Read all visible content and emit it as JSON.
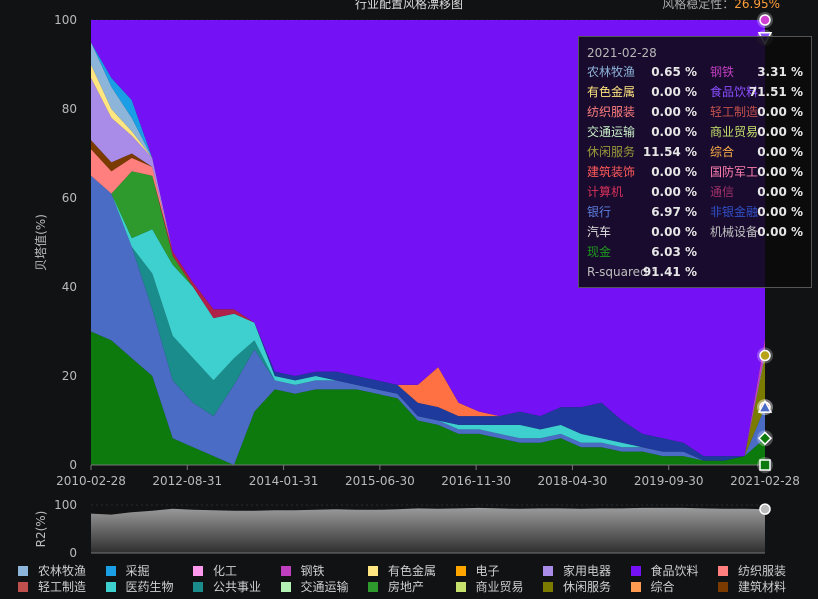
{
  "header": {
    "title": "行业配置风格漂移图",
    "stability_label": "风格稳定性：",
    "stability_value": "26.95%"
  },
  "chart_data": [
    {
      "type": "area",
      "ylabel": "贝塔值(%)",
      "ylim": [
        0,
        100
      ],
      "yticks": [
        0,
        20,
        40,
        60,
        80,
        100
      ],
      "x_tick_labels": [
        "2010-02-28",
        "2012-08-31",
        "2014-01-31",
        "2015-06-30",
        "2016-11-30",
        "2018-04-30",
        "2019-09-30",
        "2021-02-28"
      ],
      "x": [
        "2010-02",
        "2010-06",
        "2010-10",
        "2011-02",
        "2011-06",
        "2011-10",
        "2012-02",
        "2012-06",
        "2012-10",
        "2013-02",
        "2013-06",
        "2013-10",
        "2014-02",
        "2014-06",
        "2014-10",
        "2015-02",
        "2015-06",
        "2015-10",
        "2016-02",
        "2016-06",
        "2016-10",
        "2017-02",
        "2017-06",
        "2017-10",
        "2018-02",
        "2018-06",
        "2018-10",
        "2019-02",
        "2019-06",
        "2019-10",
        "2020-02",
        "2020-06",
        "2020-10",
        "2021-02"
      ],
      "series": [
        {
          "name": "现金",
          "color": "#0d7a0d",
          "values": [
            30,
            28,
            24,
            20,
            6,
            4,
            2,
            0,
            12,
            17,
            16,
            17,
            17,
            17,
            16,
            15,
            10,
            9,
            7,
            7,
            6,
            5,
            5,
            6,
            4,
            4,
            3,
            3,
            2,
            2,
            1,
            1,
            2,
            6.03
          ]
        },
        {
          "name": "银行",
          "color": "#4a6cc4",
          "values": [
            35,
            33,
            25,
            15,
            13,
            10,
            9,
            18,
            14,
            2,
            2,
            2,
            2,
            1,
            1,
            1,
            1,
            1,
            1,
            1,
            1,
            1,
            1,
            1,
            1,
            1,
            1,
            1,
            1,
            1,
            0,
            0,
            0,
            6.97
          ]
        },
        {
          "name": "公共事业",
          "color": "#1a8c8c",
          "values": [
            0,
            0,
            0,
            8,
            10,
            10,
            8,
            6,
            2,
            0,
            0,
            0,
            0,
            0,
            0,
            0,
            0,
            0,
            0,
            0,
            0,
            0,
            0,
            0,
            0,
            0,
            0,
            0,
            0,
            0,
            0,
            0,
            0,
            0
          ]
        },
        {
          "name": "医药生物",
          "color": "#3ecfcf",
          "values": [
            0,
            0,
            2,
            10,
            16,
            16,
            14,
            10,
            4,
            1,
            1,
            1,
            0,
            0,
            0,
            0,
            0,
            0,
            1,
            1,
            2,
            3,
            2,
            2,
            2,
            1,
            1,
            0,
            0,
            0,
            0,
            0,
            0,
            0
          ]
        },
        {
          "name": "房地产",
          "color": "#2e9a2e",
          "values": [
            0,
            0,
            15,
            12,
            2,
            0,
            0,
            0,
            0,
            0,
            0,
            0,
            0,
            0,
            0,
            0,
            0,
            0,
            0,
            0,
            0,
            0,
            0,
            0,
            0,
            0,
            0,
            0,
            0,
            0,
            0,
            0,
            0,
            0
          ]
        },
        {
          "name": "非银金融",
          "color": "#1e3a9c",
          "values": [
            0,
            0,
            0,
            0,
            0,
            0,
            0,
            0,
            0,
            1,
            1,
            1,
            2,
            2,
            2,
            2,
            3,
            3,
            2,
            2,
            2,
            3,
            3,
            4,
            6,
            8,
            5,
            3,
            3,
            2,
            1,
            1,
            0,
            0
          ]
        },
        {
          "name": "商业贸易",
          "color": "#b7a21a",
          "values": [
            0,
            0,
            0,
            0,
            0,
            0,
            0,
            0,
            0,
            0,
            0,
            0,
            0,
            0,
            0,
            0,
            0,
            0,
            0,
            0,
            0,
            0,
            0,
            0,
            0,
            0,
            0,
            0,
            0,
            0,
            0,
            0,
            0,
            0
          ]
        },
        {
          "name": "综合",
          "color": "#ff7043",
          "values": [
            0,
            0,
            0,
            0,
            0,
            0,
            0,
            0,
            0,
            0,
            0,
            0,
            0,
            0,
            0,
            0,
            4,
            9,
            3,
            1,
            0,
            0,
            0,
            0,
            0,
            0,
            0,
            0,
            0,
            0,
            0,
            0,
            0,
            0
          ]
        },
        {
          "name": "计算机",
          "color": "#b0214a",
          "values": [
            0,
            0,
            0,
            0,
            1,
            1,
            2,
            1,
            0,
            0,
            0,
            0,
            0,
            0,
            0,
            0,
            0,
            0,
            0,
            0,
            0,
            0,
            0,
            0,
            0,
            0,
            0,
            0,
            0,
            0,
            0,
            0,
            0,
            0
          ]
        },
        {
          "name": "纺织服装",
          "color": "#ff7f7f",
          "values": [
            6,
            5,
            3,
            2,
            0,
            0,
            0,
            0,
            0,
            0,
            0,
            0,
            0,
            0,
            0,
            0,
            0,
            0,
            0,
            0,
            0,
            0,
            0,
            0,
            0,
            0,
            0,
            0,
            0,
            0,
            0,
            0,
            0,
            0
          ]
        },
        {
          "name": "建筑材料",
          "color": "#7a3a00",
          "values": [
            2,
            2,
            1,
            0,
            0,
            0,
            0,
            0,
            0,
            0,
            0,
            0,
            0,
            0,
            0,
            0,
            0,
            0,
            0,
            0,
            0,
            0,
            0,
            0,
            0,
            0,
            0,
            0,
            0,
            0,
            0,
            0,
            0,
            0
          ]
        },
        {
          "name": "休闲服务",
          "color": "#7b7b00",
          "values": [
            0,
            0,
            0,
            0,
            0,
            0,
            0,
            0,
            0,
            0,
            0,
            0,
            0,
            0,
            0,
            0,
            0,
            0,
            0,
            0,
            0,
            0,
            0,
            0,
            0,
            0,
            0,
            0,
            0,
            0,
            0,
            0,
            0,
            11.54
          ]
        },
        {
          "name": "家用电器",
          "color": "#a98be8",
          "values": [
            14,
            10,
            4,
            2,
            0,
            0,
            0,
            0,
            0,
            0,
            0,
            0,
            0,
            0,
            0,
            0,
            0,
            0,
            0,
            0,
            0,
            0,
            0,
            0,
            0,
            0,
            0,
            0,
            0,
            0,
            0,
            0,
            0,
            0
          ]
        },
        {
          "name": "有色金属",
          "color": "#ffe680",
          "values": [
            3,
            2,
            1,
            0,
            0,
            0,
            0,
            0,
            0,
            0,
            0,
            0,
            0,
            0,
            0,
            0,
            0,
            0,
            0,
            0,
            0,
            0,
            0,
            0,
            0,
            0,
            0,
            0,
            0,
            0,
            0,
            0,
            0,
            0
          ]
        },
        {
          "name": "农林牧渔",
          "color": "#8db4d9",
          "values": [
            5,
            5,
            3,
            0,
            0,
            0,
            0,
            0,
            0,
            0,
            0,
            0,
            0,
            0,
            0,
            0,
            0,
            0,
            0,
            0,
            0,
            0,
            0,
            0,
            0,
            0,
            0,
            0,
            0,
            0,
            0,
            0,
            0,
            0.65
          ]
        },
        {
          "name": "采掘",
          "color": "#1a9ee6",
          "values": [
            0,
            2,
            4,
            0,
            0,
            0,
            0,
            0,
            0,
            0,
            0,
            0,
            0,
            0,
            0,
            0,
            0,
            0,
            0,
            0,
            0,
            0,
            0,
            0,
            0,
            0,
            0,
            0,
            0,
            0,
            0,
            0,
            0,
            0
          ]
        },
        {
          "name": "钢铁",
          "color": "#c03fc0",
          "values": [
            0,
            0,
            0,
            0,
            0,
            0,
            0,
            0,
            0,
            0,
            0,
            0,
            0,
            0,
            0,
            0,
            0,
            0,
            0,
            0,
            0,
            0,
            0,
            0,
            0,
            0,
            0,
            0,
            0,
            0,
            0,
            0,
            0,
            3.31
          ]
        },
        {
          "name": "食品饮料",
          "color": "#7411f5",
          "values": [
            5,
            13,
            18,
            31,
            52,
            59,
            65,
            65,
            68,
            79,
            80,
            79,
            79,
            80,
            81,
            82,
            82,
            78,
            86,
            88,
            89,
            88,
            89,
            87,
            87,
            86,
            90,
            93,
            94,
            95,
            98,
            98,
            98,
            71.51
          ]
        }
      ]
    },
    {
      "type": "area",
      "ylabel": "R2(%)",
      "ylim": [
        0,
        100
      ],
      "yticks": [
        0,
        100
      ],
      "x": [
        "2010-02",
        "2010-06",
        "2010-10",
        "2011-02",
        "2011-06",
        "2011-10",
        "2012-02",
        "2012-06",
        "2012-10",
        "2013-02",
        "2013-06",
        "2013-10",
        "2014-02",
        "2014-06",
        "2014-10",
        "2015-02",
        "2015-06",
        "2015-10",
        "2016-02",
        "2016-06",
        "2016-10",
        "2017-02",
        "2017-06",
        "2017-10",
        "2018-02",
        "2018-06",
        "2018-10",
        "2019-02",
        "2019-06",
        "2019-10",
        "2020-02",
        "2020-06",
        "2020-10",
        "2021-02"
      ],
      "series": [
        {
          "name": "R-squared",
          "color": "#9a9a9a",
          "values": [
            82,
            80,
            85,
            88,
            92,
            90,
            89,
            88,
            88,
            89,
            89,
            90,
            91,
            90,
            90,
            91,
            93,
            92,
            93,
            94,
            93,
            92,
            93,
            93,
            92,
            93,
            93,
            94,
            94,
            94,
            93,
            92,
            92,
            91.41
          ]
        }
      ]
    }
  ],
  "tooltip": {
    "date": "2021-02-28",
    "rows": [
      {
        "l_name": "农林牧渔",
        "l_val": "0.65 %",
        "l_color": "#8db4d9",
        "r_name": "钢铁",
        "r_val": "3.31 %",
        "r_color": "#c03fc0"
      },
      {
        "l_name": "有色金属",
        "l_val": "0.00 %",
        "l_color": "#ffe680",
        "r_name": "食品饮料",
        "r_val": "71.51 %",
        "r_color": "#8a4dff"
      },
      {
        "l_name": "纺织服装",
        "l_val": "0.00 %",
        "l_color": "#ff7f7f",
        "r_name": "轻工制造",
        "r_val": "0.00 %",
        "r_color": "#c0504d"
      },
      {
        "l_name": "交通运输",
        "l_val": "0.00 %",
        "l_color": "#c8f0c8",
        "r_name": "商业贸易",
        "r_val": "0.00 %",
        "r_color": "#c6e26c"
      },
      {
        "l_name": "休闲服务",
        "l_val": "11.54 %",
        "l_color": "#9a9a3a",
        "r_name": "综合",
        "r_val": "0.00 %",
        "r_color": "#ffb04a"
      },
      {
        "l_name": "建筑装饰",
        "l_val": "0.00 %",
        "l_color": "#ff5a5a",
        "r_name": "国防军工",
        "r_val": "0.00 %",
        "r_color": "#ff7fb0"
      },
      {
        "l_name": "计算机",
        "l_val": "0.00 %",
        "l_color": "#d6315a",
        "r_name": "通信",
        "r_val": "0.00 %",
        "r_color": "#a0306a"
      },
      {
        "l_name": "银行",
        "l_val": "6.97 %",
        "l_color": "#5b7fe0",
        "r_name": "非银金融",
        "r_val": "0.00 %",
        "r_color": "#3050c8"
      },
      {
        "l_name": "汽车",
        "l_val": "0.00 %",
        "l_color": "#e0e0e0",
        "r_name": "机械设备",
        "r_val": "0.00 %",
        "r_color": "#bfbfbf"
      },
      {
        "l_name": "现金",
        "l_val": "6.03 %",
        "l_color": "#1c9a1c",
        "r_name": "",
        "r_val": "",
        "r_color": "#bfbfbf"
      },
      {
        "l_name": "R-squared :",
        "l_val": "91.41 %",
        "l_color": "#bfbfbf",
        "r_name": "",
        "r_val": "",
        "r_color": "#bfbfbf"
      }
    ]
  },
  "legend": {
    "items": [
      {
        "label": "农林牧渔",
        "color": "#8db4d9"
      },
      {
        "label": "采掘",
        "color": "#1a9ee6"
      },
      {
        "label": "化工",
        "color": "#ff99ee"
      },
      {
        "label": "钢铁",
        "color": "#c03fc0"
      },
      {
        "label": "有色金属",
        "color": "#ffe680"
      },
      {
        "label": "电子",
        "color": "#ffa500"
      },
      {
        "label": "家用电器",
        "color": "#a98be8"
      },
      {
        "label": "食品饮料",
        "color": "#7411f5"
      },
      {
        "label": "纺织服装",
        "color": "#ff7f7f"
      },
      {
        "label": "轻工制造",
        "color": "#c0504d"
      },
      {
        "label": "医药生物",
        "color": "#3ecfcf"
      },
      {
        "label": "公共事业",
        "color": "#1a8c8c"
      },
      {
        "label": "交通运输",
        "color": "#b3f0b3"
      },
      {
        "label": "房地产",
        "color": "#2e9a2e"
      },
      {
        "label": "商业贸易",
        "color": "#c6e26c"
      },
      {
        "label": "休闲服务",
        "color": "#7b7b00"
      },
      {
        "label": "综合",
        "color": "#ff9a50"
      },
      {
        "label": "建筑材料",
        "color": "#7a3a00"
      }
    ]
  },
  "end_markers": [
    {
      "shape": "circle",
      "value": 100,
      "color": "#d040d0"
    },
    {
      "shape": "triangle-down",
      "value": 96,
      "color": "#8a4dff"
    },
    {
      "shape": "circle",
      "value": 24.6,
      "color": "#b7a21a"
    },
    {
      "shape": "circle",
      "value": 13,
      "color": "#ff7f7f"
    },
    {
      "shape": "triangle",
      "value": 13,
      "color": "#4a6cc4"
    },
    {
      "shape": "diamond",
      "value": 6,
      "color": "#0d7a0d"
    },
    {
      "shape": "square",
      "value": 0,
      "color": "#0d7a0d"
    }
  ]
}
